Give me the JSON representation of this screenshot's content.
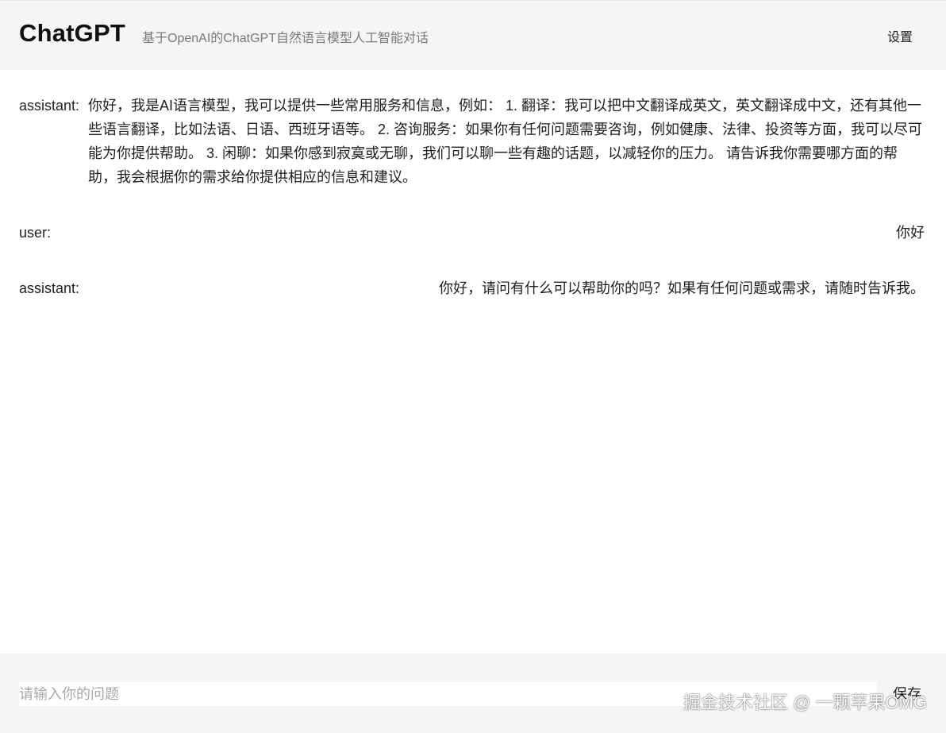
{
  "header": {
    "title": "ChatGPT",
    "subtitle": "基于OpenAI的ChatGPT自然语言模型人工智能对话",
    "settings_label": "设置"
  },
  "messages": [
    {
      "role": "assistant:",
      "text": "你好，我是AI语言模型，我可以提供一些常用服务和信息，例如： 1. 翻译：我可以把中文翻译成英文，英文翻译成中文，还有其他一些语言翻译，比如法语、日语、西班牙语等。 2. 咨询服务：如果你有任何问题需要咨询，例如健康、法律、投资等方面，我可以尽可能为你提供帮助。 3. 闲聊：如果你感到寂寞或无聊，我们可以聊一些有趣的话题，以减轻你的压力。 请告诉我你需要哪方面的帮助，我会根据你的需求给你提供相应的信息和建议。"
    },
    {
      "role": "user:",
      "text": "你好"
    },
    {
      "role": "assistant:",
      "text": "你好，请问有什么可以帮助你的吗？如果有任何问题或需求，请随时告诉我。"
    }
  ],
  "footer": {
    "input_value": "",
    "input_placeholder": "请输入你的问题",
    "save_label": "保存"
  },
  "watermark": "掘金技术社区 @ 一颗苹果OMG"
}
